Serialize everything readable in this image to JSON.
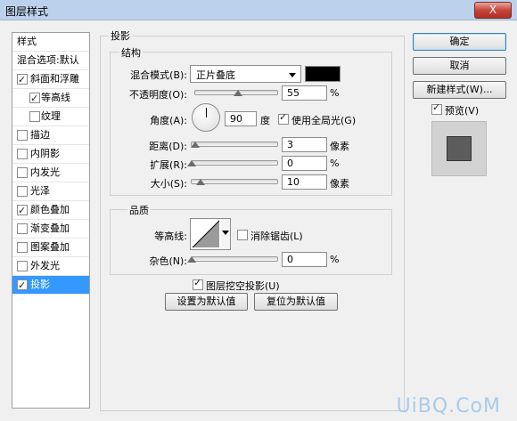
{
  "window": {
    "title": "图层样式",
    "close_label": "X"
  },
  "styles_list": [
    {
      "label": "样式",
      "kind": "head"
    },
    {
      "label": "混合选项:默认",
      "kind": "head"
    },
    {
      "label": "斜面和浮雕",
      "checked": true
    },
    {
      "label": "等高线",
      "checked": true,
      "sub": true
    },
    {
      "label": "纹理",
      "checked": false,
      "sub": true
    },
    {
      "label": "描边",
      "checked": false
    },
    {
      "label": "内阴影",
      "checked": false
    },
    {
      "label": "内发光",
      "checked": false
    },
    {
      "label": "光泽",
      "checked": false
    },
    {
      "label": "颜色叠加",
      "checked": true
    },
    {
      "label": "渐变叠加",
      "checked": false
    },
    {
      "label": "图案叠加",
      "checked": false
    },
    {
      "label": "外发光",
      "checked": false
    },
    {
      "label": "投影",
      "checked": true,
      "selected": true
    }
  ],
  "drop_shadow": {
    "section_title": "投影",
    "structure": {
      "title": "结构",
      "blend_mode_label": "混合模式(B):",
      "blend_mode_value": "正片叠底",
      "blend_color": "#000000",
      "opacity_label": "不透明度(O):",
      "opacity_value": "55",
      "opacity_unit": "%",
      "angle_label": "角度(A):",
      "angle_value": "90",
      "angle_unit": "度",
      "global_light_label": "使用全局光(G)",
      "global_light_checked": true,
      "distance_label": "距离(D):",
      "distance_value": "3",
      "distance_unit": "像素",
      "spread_label": "扩展(R):",
      "spread_value": "0",
      "spread_unit": "%",
      "size_label": "大小(S):",
      "size_value": "10",
      "size_unit": "像素"
    },
    "quality": {
      "title": "品质",
      "contour_label": "等高线:",
      "antialias_label": "消除锯齿(L)",
      "antialias_checked": false,
      "noise_label": "杂色(N):",
      "noise_value": "0",
      "noise_unit": "%"
    },
    "knockout_label": "图层挖空投影(U)",
    "knockout_checked": true,
    "make_default_label": "设置为默认值",
    "reset_default_label": "复位为默认值"
  },
  "right_panel": {
    "ok_label": "确定",
    "cancel_label": "取消",
    "new_style_label": "新建样式(W)...",
    "preview_label": "预览(V)",
    "preview_checked": true
  },
  "watermark": "UiBQ.CoM"
}
